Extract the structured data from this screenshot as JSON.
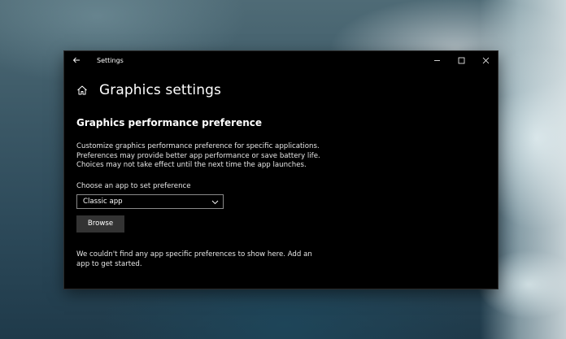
{
  "window": {
    "title": "Settings"
  },
  "page": {
    "title": "Graphics settings"
  },
  "section": {
    "title": "Graphics performance preference",
    "description": "Customize graphics performance preference for specific applications. Preferences may provide better app performance or save battery life. Choices may not take effect until the next time the app launches.",
    "choose_label": "Choose an app to set preference",
    "select_value": "Classic app",
    "browse_label": "Browse",
    "empty_message": "We couldn't find any app specific preferences to show here. Add an app to get started."
  },
  "colors": {
    "window_bg": "#000000",
    "button_bg": "#333333",
    "text": "#ffffff",
    "border": "#8a8a8a"
  },
  "icons": {
    "back": "back-arrow-icon",
    "home": "home-icon",
    "minimize": "minimize-icon",
    "maximize": "maximize-icon",
    "close": "close-icon",
    "dropdown": "chevron-down-icon"
  }
}
